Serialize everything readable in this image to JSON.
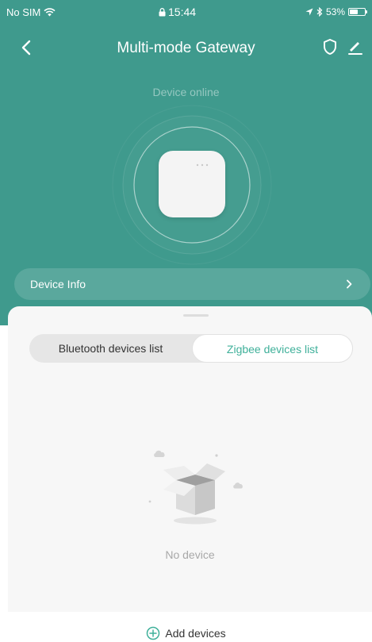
{
  "status_bar": {
    "carrier": "No SIM",
    "time": "15:44",
    "battery_percent": "53%",
    "battery_level": 0.53
  },
  "nav": {
    "title": "Multi-mode Gateway",
    "back_icon": "chevron-left-icon",
    "shield_icon": "shield-icon",
    "edit_icon": "edit-icon"
  },
  "device": {
    "status": "Device online"
  },
  "device_info": {
    "label": "Device Info"
  },
  "tabs": {
    "bluetooth": "Bluetooth devices list",
    "zigbee": "Zigbee devices list",
    "selected": "zigbee"
  },
  "empty_state": {
    "message": "No device"
  },
  "footer": {
    "add_label": "Add devices"
  },
  "colors": {
    "header_bg": "#3f9a8d",
    "accent": "#3fb09a"
  }
}
